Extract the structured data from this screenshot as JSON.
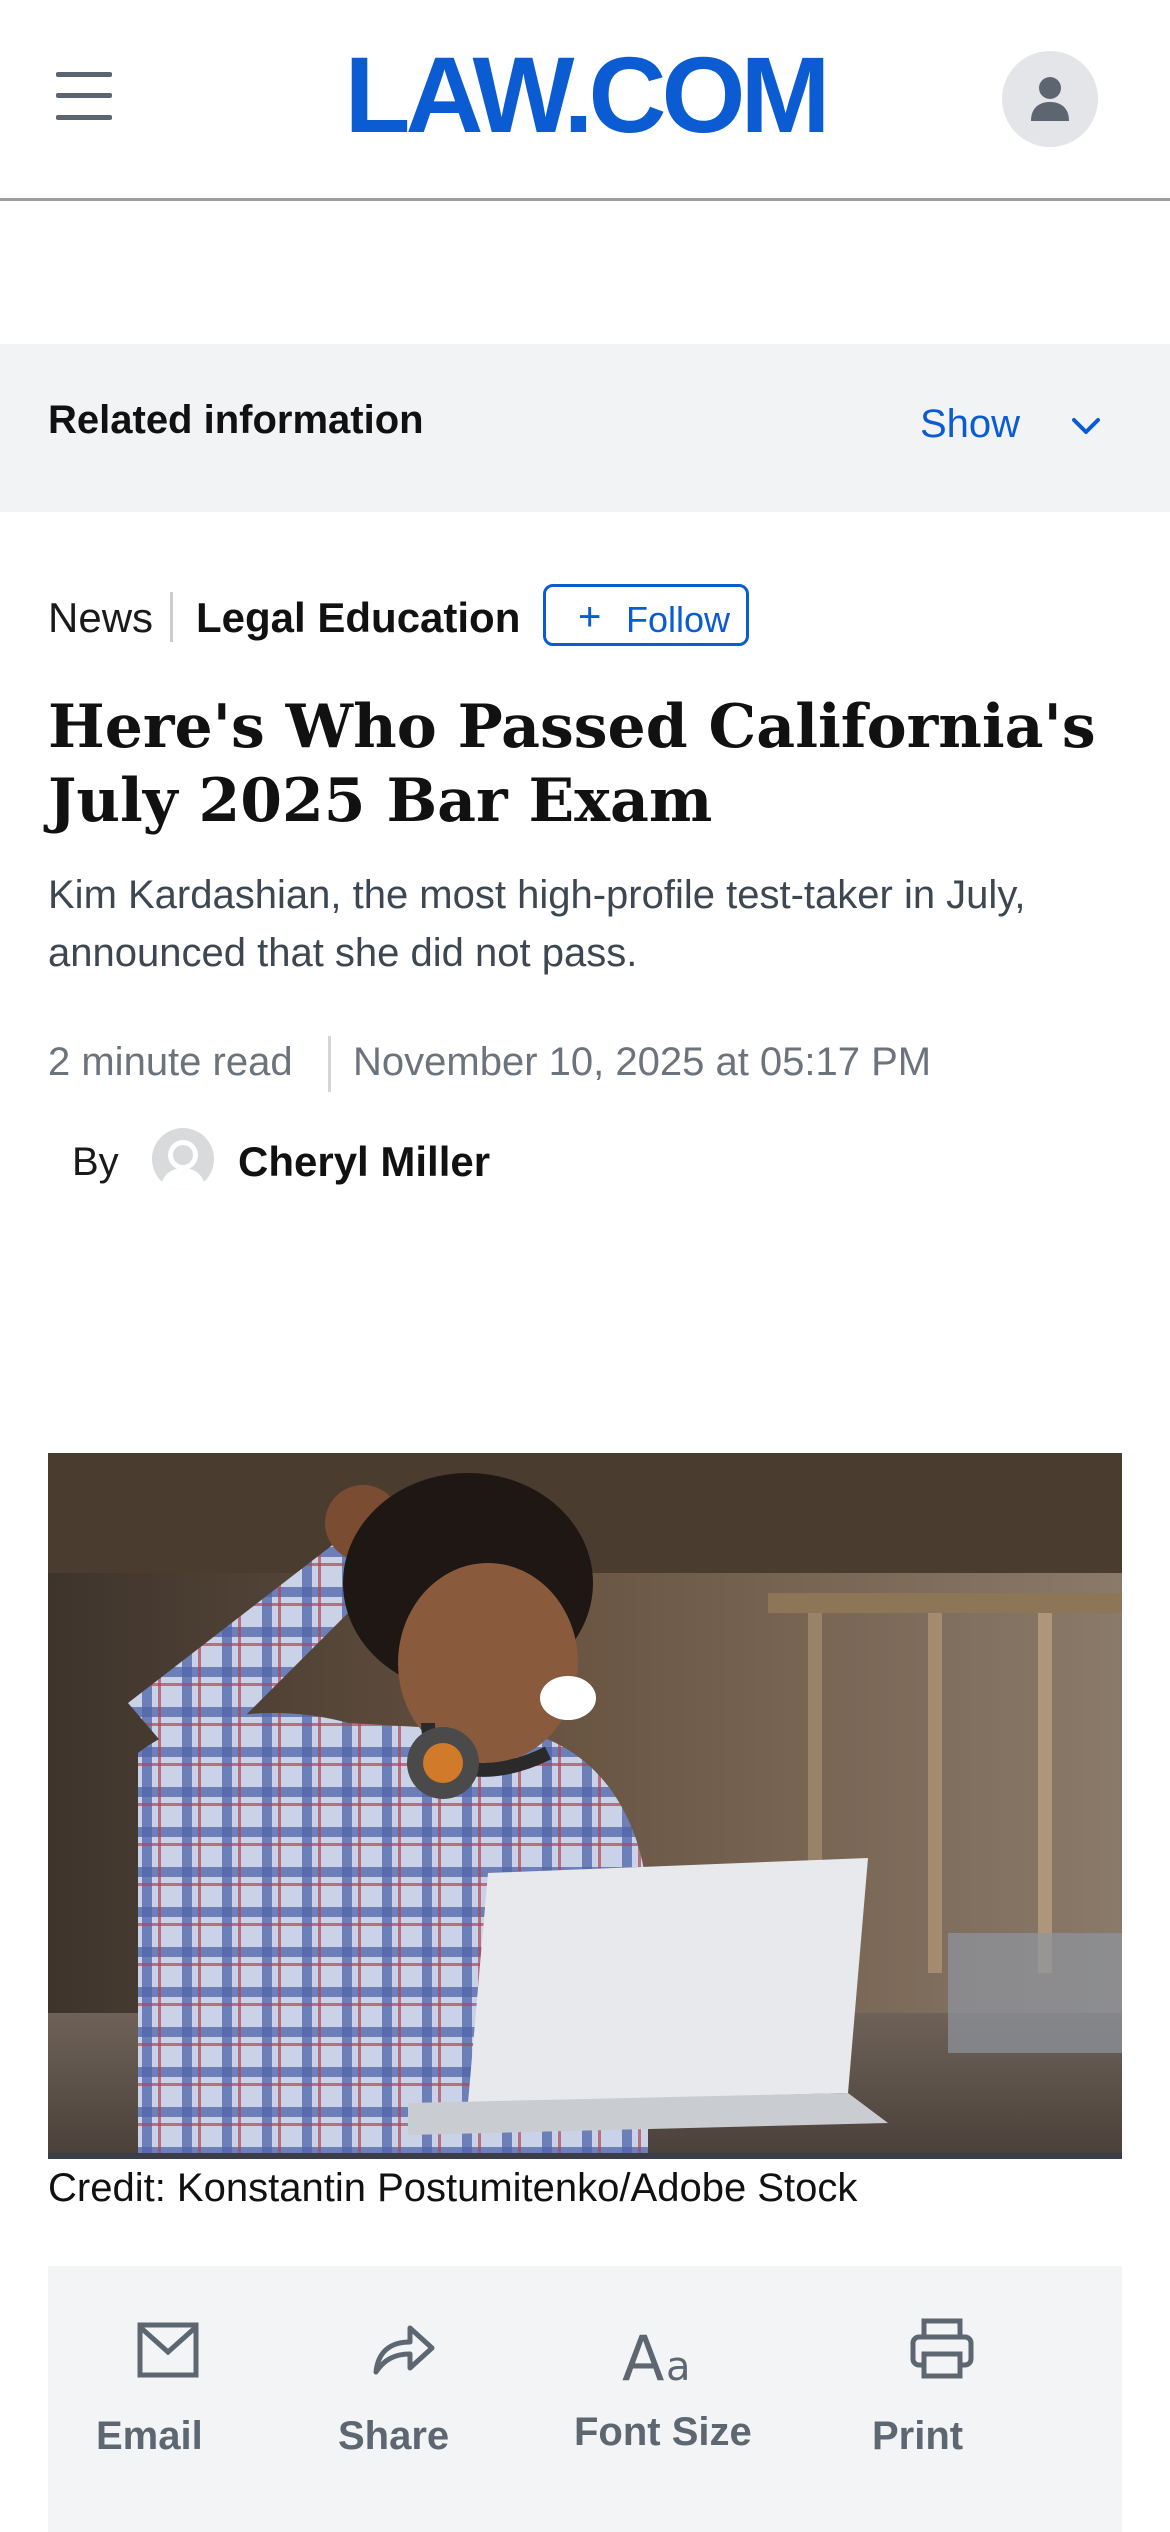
{
  "header": {
    "logo": "LAW.COM",
    "menu_icon": "hamburger-menu-icon",
    "account_icon": "user-icon"
  },
  "related": {
    "label": "Related information",
    "toggle_label": "Show",
    "toggle_icon": "chevron-down-icon"
  },
  "article": {
    "section": "News",
    "topic": "Legal Education",
    "follow_label": "Follow",
    "title": "Here's Who Passed California's July 2025 Bar Exam",
    "dek": "Kim Kardashian, the most high-profile test-taker in July, announced that she did not pass.",
    "read_time": "2 minute read",
    "date": "November 10, 2025 at 05:17 PM",
    "by_label": "By",
    "author": "Cheryl Miller",
    "image_credit": "Credit: Konstantin Postumitenko/Adobe Stock"
  },
  "tools": [
    {
      "label": "Email",
      "icon": "email-icon"
    },
    {
      "label": "Share",
      "icon": "share-icon"
    },
    {
      "label": "Font Size",
      "icon": "font-size-icon"
    },
    {
      "label": "Print",
      "icon": "print-icon"
    }
  ],
  "colors": {
    "brand": "#0b5bd3",
    "panel": "#f2f3f5",
    "muted": "#6b737c"
  }
}
